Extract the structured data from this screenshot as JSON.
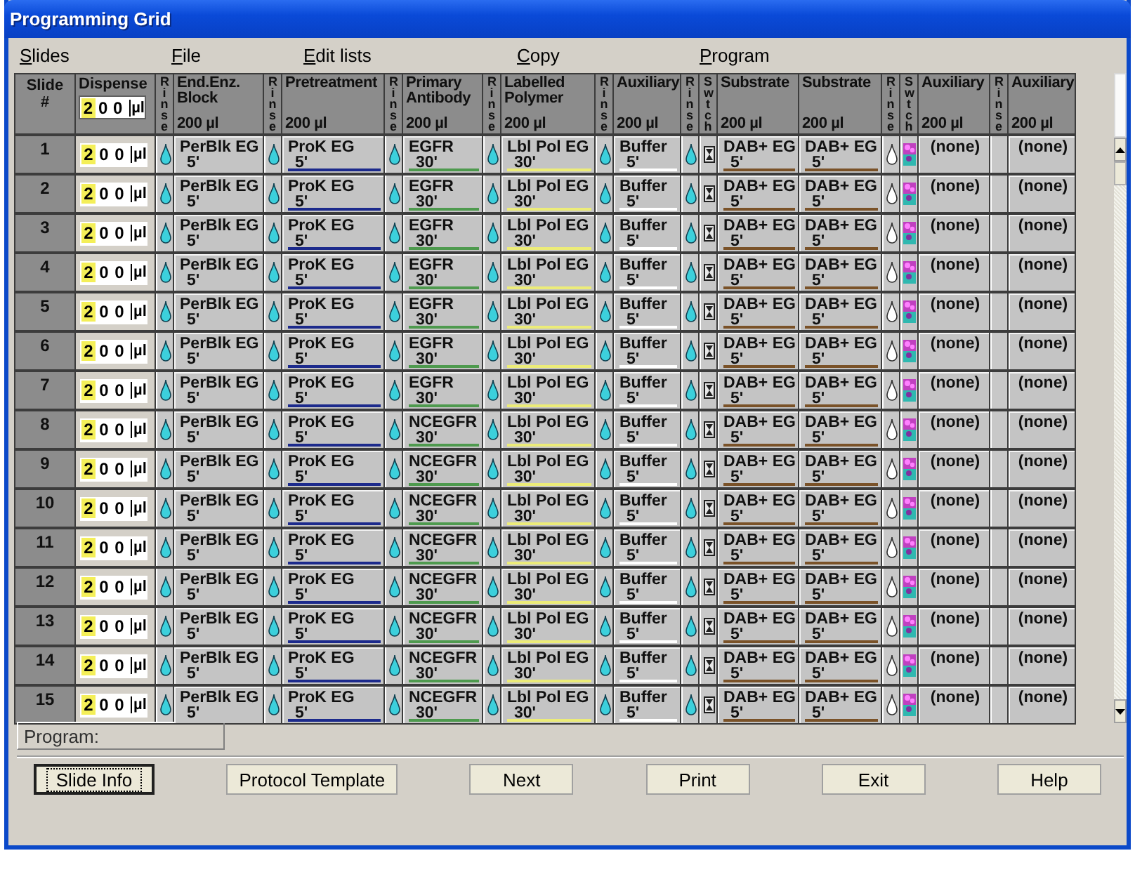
{
  "window": {
    "title": "Programming Grid"
  },
  "menu": [
    "Slides",
    "File",
    "Edit lists",
    "Copy",
    "Program"
  ],
  "columns": [
    {
      "kind": "slide",
      "label": "Slide #"
    },
    {
      "kind": "dispense",
      "label": "Dispense",
      "digits": [
        {
          "text": "2",
          "selected": true
        },
        {
          "text": "0",
          "selected": false
        },
        {
          "text": "0",
          "selected": false
        }
      ],
      "unit": "µl"
    },
    {
      "kind": "rinse",
      "label": "Rinse"
    },
    {
      "kind": "reagent",
      "label": "End.Enz. Block",
      "volume": "200 µl"
    },
    {
      "kind": "rinse",
      "label": "Rinse"
    },
    {
      "kind": "reagent",
      "label": "Pretreatment",
      "volume": "200 µl",
      "color": "#1c2a8c"
    },
    {
      "kind": "rinse",
      "label": "Rinse"
    },
    {
      "kind": "reagent",
      "label": "Primary Antibody",
      "volume": "200 µl",
      "color": "#4e9a4e"
    },
    {
      "kind": "rinse",
      "label": "Rinse"
    },
    {
      "kind": "reagent",
      "label": "Labelled Polymer",
      "volume": "200 µl",
      "color": "#ecec78"
    },
    {
      "kind": "rinse",
      "label": "Rinse"
    },
    {
      "kind": "reagent",
      "label": "Auxiliary",
      "volume": "200 µl",
      "color": "#ffffff"
    },
    {
      "kind": "rinse",
      "label": "Rinse"
    },
    {
      "kind": "switch",
      "label": "Swtch"
    },
    {
      "kind": "reagent",
      "label": "Substrate",
      "volume": "200 µl",
      "color": "#7a5228"
    },
    {
      "kind": "reagent",
      "label": "Substrate",
      "volume": "200 µl",
      "color": "#7a5228"
    },
    {
      "kind": "rinse",
      "label": "Rinse"
    },
    {
      "kind": "switch",
      "label": "Swtch"
    },
    {
      "kind": "reagent",
      "label": "Auxiliary",
      "volume": "200 µl"
    },
    {
      "kind": "rinse",
      "label": "Rinse"
    },
    {
      "kind": "reagent",
      "label": "Auxiliary",
      "volume": "200 µl"
    }
  ],
  "rows": [
    {
      "slide": "1",
      "digits": [
        {
          "text": "2",
          "selected": true
        },
        {
          "text": "0",
          "selected": false
        },
        {
          "text": "0",
          "selected": false
        }
      ],
      "unit": "µl",
      "reagents": [
        {
          "name": "PerBlk EG",
          "time": "5'"
        },
        {
          "name": "ProK EG",
          "time": "5'"
        },
        {
          "name": "EGFR",
          "time": "30'"
        },
        {
          "name": "Lbl Pol EG",
          "time": "30'"
        },
        {
          "name": "Buffer",
          "time": "5'"
        },
        {
          "name": "DAB+ EG",
          "time": "5'"
        },
        {
          "name": "DAB+ EG",
          "time": "5'"
        },
        {
          "name": "(none)"
        },
        {
          "name": "(none)"
        }
      ]
    },
    {
      "slide": "2",
      "digits": [
        {
          "text": "2",
          "selected": true
        },
        {
          "text": "0",
          "selected": false
        },
        {
          "text": "0",
          "selected": false
        }
      ],
      "unit": "µl",
      "reagents": [
        {
          "name": "PerBlk EG",
          "time": "5'"
        },
        {
          "name": "ProK EG",
          "time": "5'"
        },
        {
          "name": "EGFR",
          "time": "30'"
        },
        {
          "name": "Lbl Pol EG",
          "time": "30'"
        },
        {
          "name": "Buffer",
          "time": "5'"
        },
        {
          "name": "DAB+ EG",
          "time": "5'"
        },
        {
          "name": "DAB+ EG",
          "time": "5'"
        },
        {
          "name": "(none)"
        },
        {
          "name": "(none)"
        }
      ]
    },
    {
      "slide": "3",
      "digits": [
        {
          "text": "2",
          "selected": true
        },
        {
          "text": "0",
          "selected": false
        },
        {
          "text": "0",
          "selected": false
        }
      ],
      "unit": "µl",
      "reagents": [
        {
          "name": "PerBlk EG",
          "time": "5'"
        },
        {
          "name": "ProK EG",
          "time": "5'"
        },
        {
          "name": "EGFR",
          "time": "30'"
        },
        {
          "name": "Lbl Pol EG",
          "time": "30'"
        },
        {
          "name": "Buffer",
          "time": "5'"
        },
        {
          "name": "DAB+ EG",
          "time": "5'"
        },
        {
          "name": "DAB+ EG",
          "time": "5'"
        },
        {
          "name": "(none)"
        },
        {
          "name": "(none)"
        }
      ]
    },
    {
      "slide": "4",
      "digits": [
        {
          "text": "2",
          "selected": true
        },
        {
          "text": "0",
          "selected": false
        },
        {
          "text": "0",
          "selected": false
        }
      ],
      "unit": "µl",
      "reagents": [
        {
          "name": "PerBlk EG",
          "time": "5'"
        },
        {
          "name": "ProK EG",
          "time": "5'"
        },
        {
          "name": "EGFR",
          "time": "30'"
        },
        {
          "name": "Lbl Pol EG",
          "time": "30'"
        },
        {
          "name": "Buffer",
          "time": "5'"
        },
        {
          "name": "DAB+ EG",
          "time": "5'"
        },
        {
          "name": "DAB+ EG",
          "time": "5'"
        },
        {
          "name": "(none)"
        },
        {
          "name": "(none)"
        }
      ]
    },
    {
      "slide": "5",
      "digits": [
        {
          "text": "2",
          "selected": true
        },
        {
          "text": "0",
          "selected": false
        },
        {
          "text": "0",
          "selected": false
        }
      ],
      "unit": "µl",
      "reagents": [
        {
          "name": "PerBlk EG",
          "time": "5'"
        },
        {
          "name": "ProK EG",
          "time": "5'"
        },
        {
          "name": "EGFR",
          "time": "30'"
        },
        {
          "name": "Lbl Pol EG",
          "time": "30'"
        },
        {
          "name": "Buffer",
          "time": "5'"
        },
        {
          "name": "DAB+ EG",
          "time": "5'"
        },
        {
          "name": "DAB+ EG",
          "time": "5'"
        },
        {
          "name": "(none)"
        },
        {
          "name": "(none)"
        }
      ]
    },
    {
      "slide": "6",
      "digits": [
        {
          "text": "2",
          "selected": true
        },
        {
          "text": "0",
          "selected": false
        },
        {
          "text": "0",
          "selected": false
        }
      ],
      "unit": "µl",
      "reagents": [
        {
          "name": "PerBlk EG",
          "time": "5'"
        },
        {
          "name": "ProK EG",
          "time": "5'"
        },
        {
          "name": "EGFR",
          "time": "30'"
        },
        {
          "name": "Lbl Pol EG",
          "time": "30'"
        },
        {
          "name": "Buffer",
          "time": "5'"
        },
        {
          "name": "DAB+ EG",
          "time": "5'"
        },
        {
          "name": "DAB+ EG",
          "time": "5'"
        },
        {
          "name": "(none)"
        },
        {
          "name": "(none)"
        }
      ]
    },
    {
      "slide": "7",
      "digits": [
        {
          "text": "2",
          "selected": true
        },
        {
          "text": "0",
          "selected": false
        },
        {
          "text": "0",
          "selected": false
        }
      ],
      "unit": "µl",
      "reagents": [
        {
          "name": "PerBlk EG",
          "time": "5'"
        },
        {
          "name": "ProK EG",
          "time": "5'"
        },
        {
          "name": "EGFR",
          "time": "30'"
        },
        {
          "name": "Lbl Pol EG",
          "time": "30'"
        },
        {
          "name": "Buffer",
          "time": "5'"
        },
        {
          "name": "DAB+ EG",
          "time": "5'"
        },
        {
          "name": "DAB+ EG",
          "time": "5'"
        },
        {
          "name": "(none)"
        },
        {
          "name": "(none)"
        }
      ]
    },
    {
      "slide": "8",
      "digits": [
        {
          "text": "2",
          "selected": true
        },
        {
          "text": "0",
          "selected": false
        },
        {
          "text": "0",
          "selected": false
        }
      ],
      "unit": "µl",
      "reagents": [
        {
          "name": "PerBlk EG",
          "time": "5'"
        },
        {
          "name": "ProK EG",
          "time": "5'"
        },
        {
          "name": "NCEGFR",
          "time": "30'"
        },
        {
          "name": "Lbl Pol EG",
          "time": "30'"
        },
        {
          "name": "Buffer",
          "time": "5'"
        },
        {
          "name": "DAB+ EG",
          "time": "5'"
        },
        {
          "name": "DAB+ EG",
          "time": "5'"
        },
        {
          "name": "(none)"
        },
        {
          "name": "(none)"
        }
      ]
    },
    {
      "slide": "9",
      "digits": [
        {
          "text": "2",
          "selected": true
        },
        {
          "text": "0",
          "selected": false
        },
        {
          "text": "0",
          "selected": false
        }
      ],
      "unit": "µl",
      "reagents": [
        {
          "name": "PerBlk EG",
          "time": "5'"
        },
        {
          "name": "ProK EG",
          "time": "5'"
        },
        {
          "name": "NCEGFR",
          "time": "30'"
        },
        {
          "name": "Lbl Pol EG",
          "time": "30'"
        },
        {
          "name": "Buffer",
          "time": "5'"
        },
        {
          "name": "DAB+ EG",
          "time": "5'"
        },
        {
          "name": "DAB+ EG",
          "time": "5'"
        },
        {
          "name": "(none)"
        },
        {
          "name": "(none)"
        }
      ]
    },
    {
      "slide": "10",
      "digits": [
        {
          "text": "2",
          "selected": true
        },
        {
          "text": "0",
          "selected": false
        },
        {
          "text": "0",
          "selected": false
        }
      ],
      "unit": "µl",
      "reagents": [
        {
          "name": "PerBlk EG",
          "time": "5'"
        },
        {
          "name": "ProK EG",
          "time": "5'"
        },
        {
          "name": "NCEGFR",
          "time": "30'"
        },
        {
          "name": "Lbl Pol EG",
          "time": "30'"
        },
        {
          "name": "Buffer",
          "time": "5'"
        },
        {
          "name": "DAB+ EG",
          "time": "5'"
        },
        {
          "name": "DAB+ EG",
          "time": "5'"
        },
        {
          "name": "(none)"
        },
        {
          "name": "(none)"
        }
      ]
    },
    {
      "slide": "11",
      "digits": [
        {
          "text": "2",
          "selected": true
        },
        {
          "text": "0",
          "selected": false
        },
        {
          "text": "0",
          "selected": false
        }
      ],
      "unit": "µl",
      "reagents": [
        {
          "name": "PerBlk EG",
          "time": "5'"
        },
        {
          "name": "ProK EG",
          "time": "5'"
        },
        {
          "name": "NCEGFR",
          "time": "30'"
        },
        {
          "name": "Lbl Pol EG",
          "time": "30'"
        },
        {
          "name": "Buffer",
          "time": "5'"
        },
        {
          "name": "DAB+ EG",
          "time": "5'"
        },
        {
          "name": "DAB+ EG",
          "time": "5'"
        },
        {
          "name": "(none)"
        },
        {
          "name": "(none)"
        }
      ]
    },
    {
      "slide": "12",
      "digits": [
        {
          "text": "2",
          "selected": true
        },
        {
          "text": "0",
          "selected": false
        },
        {
          "text": "0",
          "selected": false
        }
      ],
      "unit": "µl",
      "reagents": [
        {
          "name": "PerBlk EG",
          "time": "5'"
        },
        {
          "name": "ProK EG",
          "time": "5'"
        },
        {
          "name": "NCEGFR",
          "time": "30'"
        },
        {
          "name": "Lbl Pol EG",
          "time": "30'"
        },
        {
          "name": "Buffer",
          "time": "5'"
        },
        {
          "name": "DAB+ EG",
          "time": "5'"
        },
        {
          "name": "DAB+ EG",
          "time": "5'"
        },
        {
          "name": "(none)"
        },
        {
          "name": "(none)"
        }
      ]
    },
    {
      "slide": "13",
      "digits": [
        {
          "text": "2",
          "selected": true
        },
        {
          "text": "0",
          "selected": false
        },
        {
          "text": "0",
          "selected": false
        }
      ],
      "unit": "µl",
      "reagents": [
        {
          "name": "PerBlk EG",
          "time": "5'"
        },
        {
          "name": "ProK EG",
          "time": "5'"
        },
        {
          "name": "NCEGFR",
          "time": "30'"
        },
        {
          "name": "Lbl Pol EG",
          "time": "30'"
        },
        {
          "name": "Buffer",
          "time": "5'"
        },
        {
          "name": "DAB+ EG",
          "time": "5'"
        },
        {
          "name": "DAB+ EG",
          "time": "5'"
        },
        {
          "name": "(none)"
        },
        {
          "name": "(none)"
        }
      ]
    },
    {
      "slide": "14",
      "digits": [
        {
          "text": "2",
          "selected": true
        },
        {
          "text": "0",
          "selected": false
        },
        {
          "text": "0",
          "selected": false
        }
      ],
      "unit": "µl",
      "reagents": [
        {
          "name": "PerBlk EG",
          "time": "5'"
        },
        {
          "name": "ProK EG",
          "time": "5'"
        },
        {
          "name": "NCEGFR",
          "time": "30'"
        },
        {
          "name": "Lbl Pol EG",
          "time": "30'"
        },
        {
          "name": "Buffer",
          "time": "5'"
        },
        {
          "name": "DAB+ EG",
          "time": "5'"
        },
        {
          "name": "DAB+ EG",
          "time": "5'"
        },
        {
          "name": "(none)"
        },
        {
          "name": "(none)"
        }
      ]
    },
    {
      "slide": "15",
      "digits": [
        {
          "text": "2",
          "selected": true
        },
        {
          "text": "0",
          "selected": false
        },
        {
          "text": "0",
          "selected": false
        }
      ],
      "unit": "µl",
      "reagents": [
        {
          "name": "PerBlk EG",
          "time": "5'"
        },
        {
          "name": "ProK EG",
          "time": "5'"
        },
        {
          "name": "NCEGFR",
          "time": "30'"
        },
        {
          "name": "Lbl Pol EG",
          "time": "30'"
        },
        {
          "name": "Buffer",
          "time": "5'"
        },
        {
          "name": "DAB+ EG",
          "time": "5'"
        },
        {
          "name": "DAB+ EG",
          "time": "5'"
        },
        {
          "name": "(none)"
        },
        {
          "name": "(none)"
        }
      ]
    }
  ],
  "program_field": {
    "label": "Program:"
  },
  "buttons": [
    {
      "label": "Slide Info",
      "focused": true
    },
    {
      "label": "Protocol Template",
      "focused": false
    },
    {
      "label": "Next",
      "focused": false
    },
    {
      "label": "Print",
      "focused": false
    },
    {
      "label": "Exit",
      "focused": false
    },
    {
      "label": "Help",
      "focused": false
    }
  ]
}
